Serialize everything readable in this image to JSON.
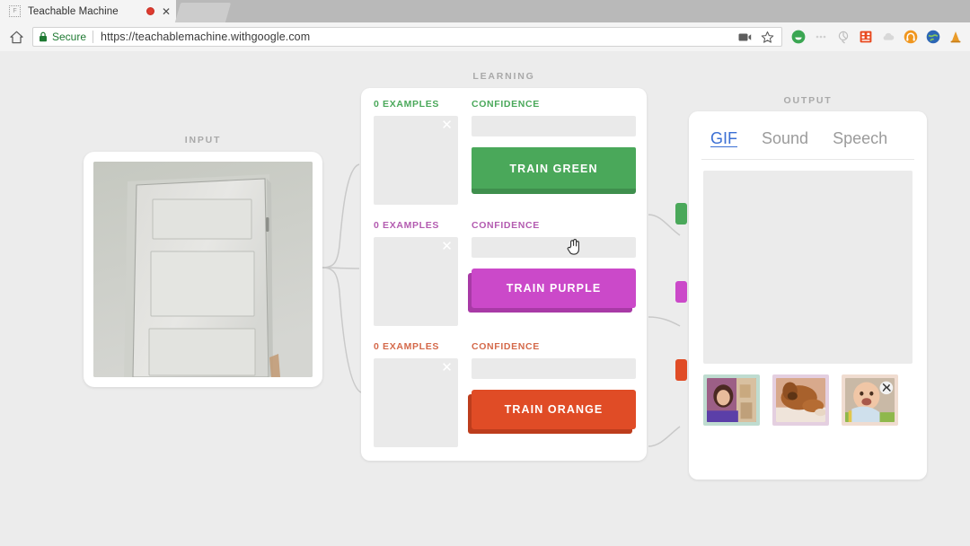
{
  "browser": {
    "tab_title": "Teachable Machine",
    "tab_favicon_glyph": "F",
    "tab_close_glyph": "✕",
    "secure_label": "Secure",
    "url": "https://teachablemachine.withgoogle.com",
    "home_icon": "home-icon",
    "lock_icon": "lock-icon",
    "cast_icon": "cast-icon",
    "bookmark_icon": "star-icon",
    "extensions": [
      {
        "name": "extension-green-circle-icon",
        "color": "#3aa652"
      },
      {
        "name": "extension-dots-icon",
        "color": "#cfcfcf"
      },
      {
        "name": "extension-pin-icon",
        "color": "#bdbdbd"
      },
      {
        "name": "extension-red-grid-icon",
        "color": "#e8491f"
      },
      {
        "name": "extension-cloud-icon",
        "color": "#d2d2d2"
      },
      {
        "name": "extension-headphones-icon",
        "color": "#f0961e"
      },
      {
        "name": "extension-globe-icon",
        "color": "#2c66b5"
      },
      {
        "name": "extension-cone-icon",
        "color": "#e99b2a"
      }
    ]
  },
  "page": {
    "input": {
      "label": "INPUT",
      "webcam_alt": "webcam-view-of-white-panel-door"
    },
    "learning": {
      "label": "LEARNING",
      "clear_glyph": "✕",
      "classes": [
        {
          "id": "green",
          "examples_label": "0 EXAMPLES",
          "confidence_label": "CONFIDENCE",
          "train_label": "TRAIN GREEN",
          "color": "#4aa85a",
          "shade": "#3f8f4d",
          "text_color": "#4aa85a",
          "confidence_value": 0,
          "example_count": 0,
          "state": "pressed"
        },
        {
          "id": "purple",
          "examples_label": "0 EXAMPLES",
          "confidence_label": "CONFIDENCE",
          "train_label": "TRAIN PURPLE",
          "color": "#cb49c9",
          "shade": "#a83aa6",
          "text_color": "#b35bb0",
          "confidence_value": 0,
          "example_count": 0,
          "state": "raised"
        },
        {
          "id": "orange",
          "examples_label": "0 EXAMPLES",
          "confidence_label": "CONFIDENCE",
          "train_label": "TRAIN ORANGE",
          "color": "#e04c26",
          "shade": "#bd3d1d",
          "text_color": "#d4694a",
          "confidence_value": 0,
          "example_count": 0,
          "state": "raised"
        }
      ],
      "cursor": "pointing-hand-cursor"
    },
    "output": {
      "label": "OUTPUT",
      "tabs": [
        {
          "label": "GIF",
          "active": true
        },
        {
          "label": "Sound",
          "active": false
        },
        {
          "label": "Speech",
          "active": false
        }
      ],
      "preview_alt": "empty-gif-preview",
      "thumbnails": [
        {
          "name": "thumbnail-girl",
          "border": "#bfdcd0",
          "alt": "girl-in-purple-shirt"
        },
        {
          "name": "thumbnail-dog",
          "border": "#e4cfe0",
          "alt": "brown-dog-lying-down"
        },
        {
          "name": "thumbnail-baby",
          "border": "#f0dcd0",
          "alt": "laughing-baby"
        }
      ]
    }
  }
}
